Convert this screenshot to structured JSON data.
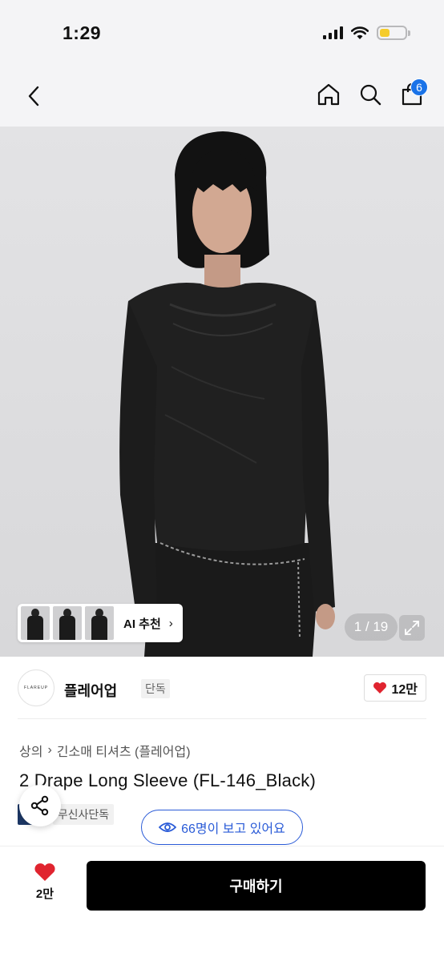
{
  "status": {
    "time": "1:29"
  },
  "nav": {
    "cart_count": "6"
  },
  "gallery": {
    "ai_label": "AI 추천",
    "counter": "1 / 19"
  },
  "brand": {
    "logo_text": "FLAREUP",
    "name": "플레어업",
    "tag": "단독",
    "likes": "12만"
  },
  "product": {
    "breadcrumb": [
      "상의",
      "긴소매 티셔츠 (플레어업)"
    ],
    "title": "2 Drape Long Sleeve (FL-146_Black)",
    "tags": [
      "데이",
      "무신사단독"
    ]
  },
  "viewers": {
    "text": "66명이 보고 있어요"
  },
  "bottom": {
    "wish_count": "2만",
    "buy_label": "구매하기"
  },
  "colors": {
    "accent": "#2a5bd7",
    "badge": "#1a73e8",
    "heart": "#e0242f",
    "buy": "#000000"
  }
}
